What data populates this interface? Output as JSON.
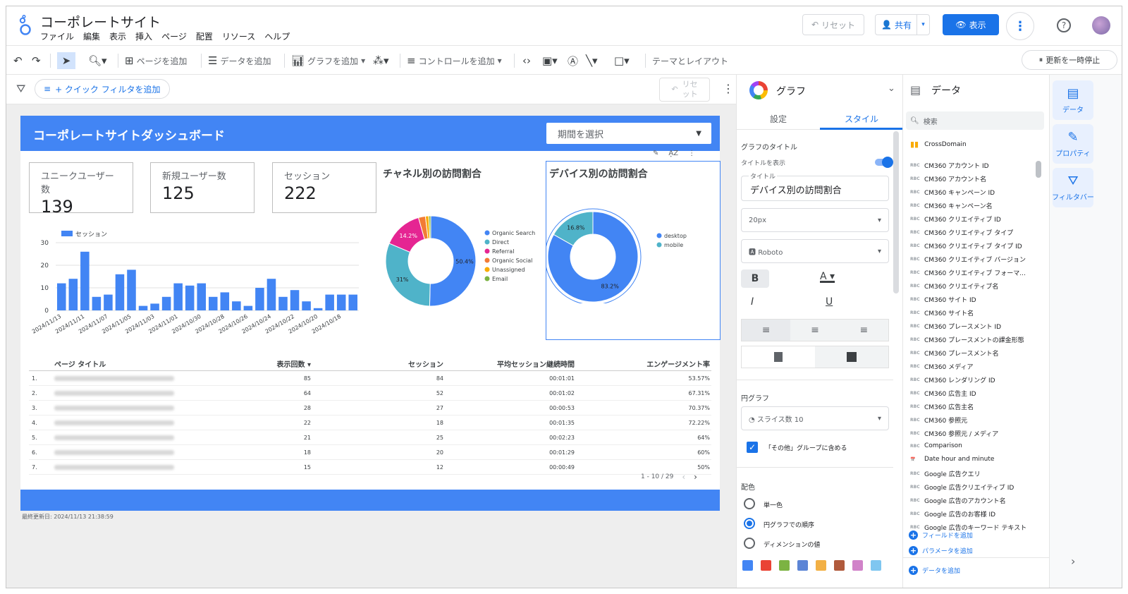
{
  "app": {
    "title": "コーポレートサイト",
    "menu": [
      "ファイル",
      "編集",
      "表示",
      "挿入",
      "ページ",
      "配置",
      "リソース",
      "ヘルプ"
    ],
    "reset_label": "リセット",
    "share_label": "共有",
    "view_label": "表示"
  },
  "toolbar": {
    "add_page": "ページを追加",
    "add_data": "データを追加",
    "add_chart": "グラフを追加",
    "add_control": "コントロールを追加",
    "theme_layout": "テーマとレイアウト",
    "pause_updates": "更新を一時停止"
  },
  "filterbar": {
    "quick_filter": "+ クイック フィルタを追加",
    "reset_label_1": "リセ",
    "reset_label_2": "ット"
  },
  "report": {
    "title": "コーポレートサイトダッシュボード",
    "date_picker": "期間を選択",
    "kpis": [
      {
        "label": "ユニークユーザー数",
        "value": "139"
      },
      {
        "label": "新規ユーザー数",
        "value": "125"
      },
      {
        "label": "セッション",
        "value": "222"
      }
    ],
    "channel_title": "チャネル別の訪問割合",
    "device_title": "デバイス別の訪問割合",
    "last_updated": "最終更新日: 2024/11/13 21:38:59",
    "pager": "1 - 10 / 29"
  },
  "table": {
    "headers": [
      "ページ タイトル",
      "表示回数 ▾",
      "セッション",
      "平均セッション継続時間",
      "エンゲージメント率"
    ],
    "rows": [
      {
        "n": "1.",
        "views": "85",
        "sessions": "84",
        "duration": "00:01:01",
        "engagement": "53.57%"
      },
      {
        "n": "2.",
        "views": "64",
        "sessions": "52",
        "duration": "00:01:02",
        "engagement": "67.31%"
      },
      {
        "n": "3.",
        "views": "28",
        "sessions": "27",
        "duration": "00:00:53",
        "engagement": "70.37%"
      },
      {
        "n": "4.",
        "views": "22",
        "sessions": "18",
        "duration": "00:01:35",
        "engagement": "72.22%"
      },
      {
        "n": "5.",
        "views": "21",
        "sessions": "25",
        "duration": "00:02:23",
        "engagement": "64%"
      },
      {
        "n": "6.",
        "views": "18",
        "sessions": "20",
        "duration": "00:01:29",
        "engagement": "60%"
      },
      {
        "n": "7.",
        "views": "15",
        "sessions": "12",
        "duration": "00:00:49",
        "engagement": "50%"
      }
    ]
  },
  "chart_data": [
    {
      "type": "bar",
      "series": [
        {
          "name": "セッション",
          "values": [
            12,
            14,
            26,
            6,
            7,
            16,
            18,
            2,
            3,
            6,
            12,
            11,
            12,
            6,
            8,
            4,
            2,
            10,
            14,
            6,
            9,
            4,
            1,
            7,
            7,
            7
          ]
        }
      ],
      "x_tick_labels": [
        "2024/11/13",
        "2024/11/11",
        "2024/11/07",
        "2024/11/05",
        "2024/11/03",
        "2024/11/01",
        "2024/10/30",
        "2024/10/28",
        "2024/10/26",
        "2024/10/24",
        "2024/10/22",
        "2024/10/20",
        "2024/10/18"
      ],
      "y_ticks": [
        "30",
        "20",
        "10",
        "0"
      ],
      "ylim": [
        0,
        30
      ],
      "color": "#4285f4"
    },
    {
      "type": "pie",
      "title": "チャネル別の訪問割合",
      "labels": [
        "Organic Search",
        "Direct",
        "Referral",
        "Organic Social",
        "Unassigned",
        "Email"
      ],
      "values": [
        50.4,
        31,
        14.2,
        2.5,
        1.2,
        0.7
      ],
      "value_labels": [
        "50.4%",
        "31%",
        "14.2%",
        "",
        "",
        ""
      ],
      "colors": [
        "#4285f4",
        "#4fb3c9",
        "#e52592",
        "#f27b35",
        "#f9ab00",
        "#7cb342"
      ]
    },
    {
      "type": "pie",
      "title": "デバイス別の訪問割合",
      "labels": [
        "desktop",
        "mobile"
      ],
      "values": [
        83.2,
        16.8
      ],
      "value_labels": [
        "83.2%",
        "16.8%"
      ],
      "colors": [
        "#4285f4",
        "#4fb3c9"
      ]
    }
  ],
  "graph_panel": {
    "title": "グラフ",
    "tab_setup": "設定",
    "tab_style": "スタイル",
    "chart_title_section": "グラフのタイトル",
    "show_title": "タイトルを表示",
    "title_legend": "タイトル",
    "title_value": "デバイス別の訪問割合",
    "font_size": "20px",
    "font_family": "Roboto",
    "pie_section": "円グラフ",
    "slice_count": "スライス数 10",
    "group_others": "「その他」グループに含める",
    "color_section": "配色",
    "color_options": [
      "単一色",
      "円グラフでの順序",
      "ディメンションの値"
    ],
    "swatches": [
      "#4285f4",
      "#ea4335",
      "#7cb342",
      "#5c85d6",
      "#f2b045",
      "#b05a3c",
      "#d183c9",
      "#7fc6f0"
    ]
  },
  "data_panel": {
    "title": "データ",
    "search_placeholder": "検索",
    "source": "CrossDomain",
    "fields": [
      {
        "t": "RBC",
        "name": "CM360 アカウント ID"
      },
      {
        "t": "RBC",
        "name": "CM360 アカウント名"
      },
      {
        "t": "RBC",
        "name": "CM360 キャンペーン ID"
      },
      {
        "t": "RBC",
        "name": "CM360 キャンペーン名"
      },
      {
        "t": "RBC",
        "name": "CM360 クリエイティブ ID"
      },
      {
        "t": "RBC",
        "name": "CM360 クリエイティブ タイプ"
      },
      {
        "t": "RBC",
        "name": "CM360 クリエイティブ タイプ ID"
      },
      {
        "t": "RBC",
        "name": "CM360 クリエイティブ バージョン"
      },
      {
        "t": "RBC",
        "name": "CM360 クリエイティブ フォーマ..."
      },
      {
        "t": "RBC",
        "name": "CM360 クリエイティブ名"
      },
      {
        "t": "RBC",
        "name": "CM360 サイト ID"
      },
      {
        "t": "RBC",
        "name": "CM360 サイト名"
      },
      {
        "t": "RBC",
        "name": "CM360 プレースメント ID"
      },
      {
        "t": "RBC",
        "name": "CM360 プレースメントの課金形態"
      },
      {
        "t": "RBC",
        "name": "CM360 プレースメント名"
      },
      {
        "t": "RBC",
        "name": "CM360 メディア"
      },
      {
        "t": "RBC",
        "name": "CM360 レンダリング ID"
      },
      {
        "t": "RBC",
        "name": "CM360 広告主 ID"
      },
      {
        "t": "RBC",
        "name": "CM360 広告主名"
      },
      {
        "t": "RBC",
        "name": "CM360 参照元"
      },
      {
        "t": "RBC",
        "name": "CM360 参照元 / メディア"
      },
      {
        "t": "RBC",
        "name": "Comparison"
      },
      {
        "t": "📅",
        "name": "Date hour and minute"
      },
      {
        "t": "RBC",
        "name": "Google 広告クエリ"
      },
      {
        "t": "RBC",
        "name": "Google 広告クリエイティブ ID"
      },
      {
        "t": "RBC",
        "name": "Google 広告のアカウント名"
      },
      {
        "t": "RBC",
        "name": "Google 広告のお客様 ID"
      },
      {
        "t": "RBC",
        "name": "Google 広告のキーワード テキスト"
      }
    ],
    "add_field": "フィールドを追加",
    "add_param": "パラメータを追加",
    "add_data": "データを追加"
  },
  "rail": {
    "data": "データ",
    "props": "プロパティ",
    "filter": "フィルタバー"
  }
}
